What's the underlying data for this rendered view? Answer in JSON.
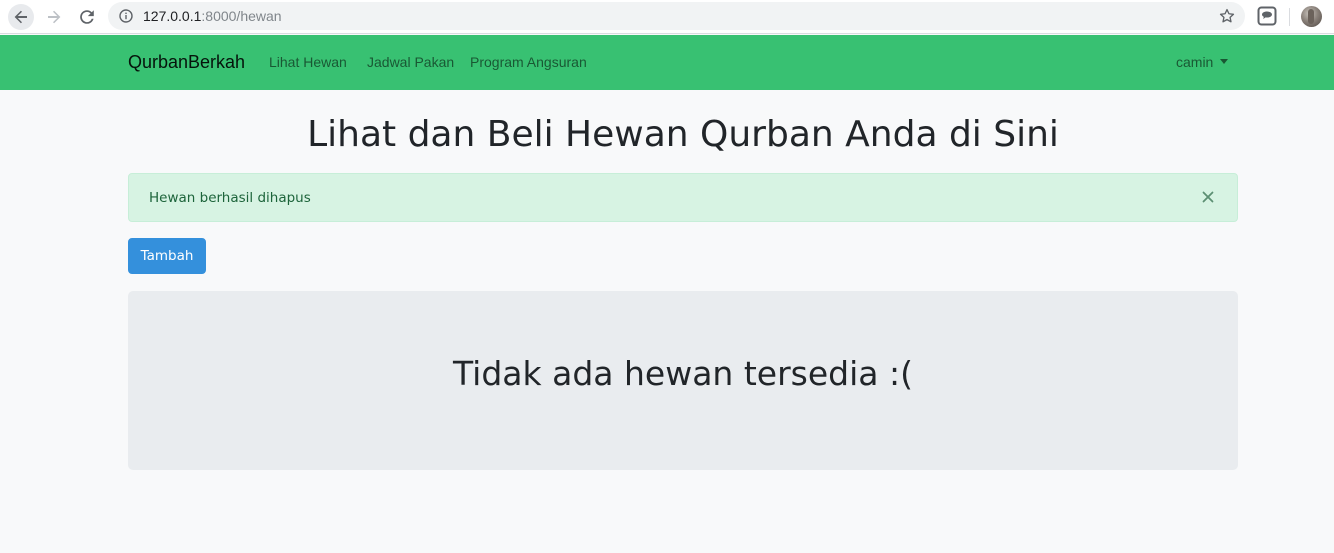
{
  "browser": {
    "url_host": "127.0.0.1",
    "url_path": ":8000/hewan"
  },
  "navbar": {
    "brand": "QurbanBerkah",
    "links": [
      "Lihat Hewan",
      "Jadwal Pakan",
      "Program Angsuran"
    ],
    "user": "camin",
    "color": "#38c172"
  },
  "main": {
    "title": "Lihat dan Beli Hewan Qurban Anda di Sini",
    "alert": {
      "message": "Hewan berhasil dihapus",
      "color": "#d7f3e3"
    },
    "add_button": "Tambah",
    "empty_message": "Tidak ada hewan tersedia :("
  },
  "icons": {
    "back": "arrow-left-icon",
    "forward": "arrow-right-icon",
    "reload": "reload-icon",
    "info": "info-icon",
    "star": "star-icon",
    "extension": "chat-extension-icon",
    "close": "close-icon"
  }
}
